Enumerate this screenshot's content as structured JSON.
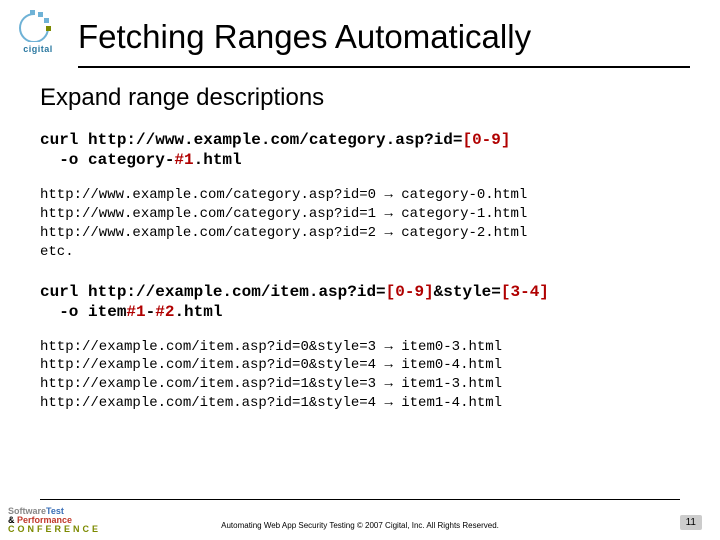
{
  "brand": {
    "name": "cigital"
  },
  "title": "Fetching Ranges Automatically",
  "subtitle": "Expand range descriptions",
  "code1": {
    "prefix": "curl http://www.example.com/category.asp?id=",
    "range": "[0-9]",
    "line2a": "  -o category-",
    "hash": "#1",
    "line2b": ".html"
  },
  "list1": {
    "l1": "http://www.example.com/category.asp?id=0 → category-0.html",
    "l2": "http://www.example.com/category.asp?id=1 → category-1.html",
    "l3": "http://www.example.com/category.asp?id=2 → category-2.html",
    "l4": "etc."
  },
  "code2": {
    "prefix": "curl http://example.com/item.asp?id=",
    "r1": "[0-9]",
    "mid": "&style=",
    "r2": "[3-4]",
    "line2a": "  -o item",
    "h1": "#1",
    "dash": "-",
    "h2": "#2",
    "line2b": ".html"
  },
  "list2": {
    "l1": "http://example.com/item.asp?id=0&style=3 → item0-3.html",
    "l2": "http://example.com/item.asp?id=0&style=4 → item0-4.html",
    "l3": "http://example.com/item.asp?id=1&style=3 → item1-3.html",
    "l4": "http://example.com/item.asp?id=1&style=4 → item1-4.html"
  },
  "footer": {
    "text": "Automating Web App Security Testing  © 2007 Cigital, Inc. All Rights Reserved.",
    "page": "11",
    "logo": {
      "soft": "Software",
      "test": "Test",
      "amp": "&",
      "perf": "Performance",
      "conf": "CONFERENCE"
    }
  }
}
